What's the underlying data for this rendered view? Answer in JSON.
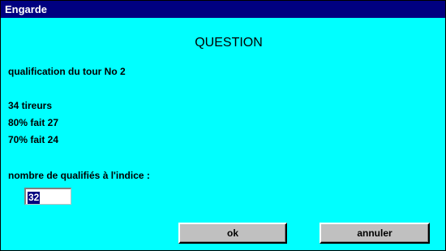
{
  "window": {
    "title": "Engarde"
  },
  "dialog": {
    "heading": "QUESTION",
    "qualification": "qualification du tour No 2",
    "shooters": "34 tireurs",
    "pct80": "80% fait 27",
    "pct70": "70% fait 24",
    "prompt": "nombre de qualifiés à l'indice :",
    "input_value": "32"
  },
  "buttons": {
    "ok": "ok",
    "cancel": "annuler"
  },
  "colors": {
    "background": "#00ffff",
    "titlebar": "#000080",
    "button": "#c0c0c0"
  }
}
